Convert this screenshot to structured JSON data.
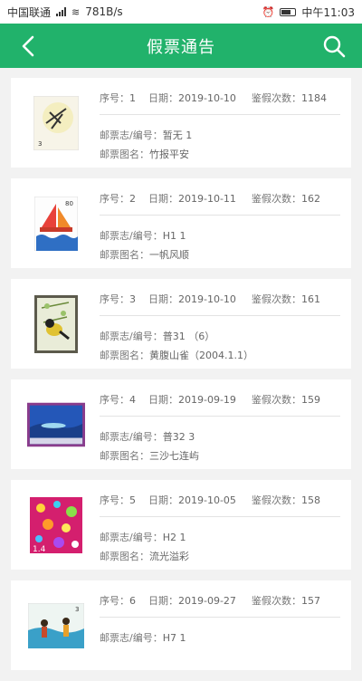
{
  "statusbar": {
    "carrier": "中国联通",
    "speed": "781B/s",
    "time": "中午11:03"
  },
  "header": {
    "title": "假票通告"
  },
  "labels": {
    "seq": "序号：",
    "date": "日期：",
    "count": "鉴假次数：",
    "code": "邮票志/编号：",
    "name": "邮票图名："
  },
  "cards": [
    {
      "seq": "1",
      "date": "2019-10-10",
      "count": "1184",
      "code": "暂无  1",
      "name": "竹报平安"
    },
    {
      "seq": "2",
      "date": "2019-10-11",
      "count": "162",
      "code": "H1  1",
      "name": "一帆风顺"
    },
    {
      "seq": "3",
      "date": "2019-10-10",
      "count": "161",
      "code": "普31  （6）",
      "name": "黄腹山雀（2004.1.1）"
    },
    {
      "seq": "4",
      "date": "2019-09-19",
      "count": "159",
      "code": "普32  3",
      "name": "三沙七连屿"
    },
    {
      "seq": "5",
      "date": "2019-10-05",
      "count": "158",
      "code": "H2  1",
      "name": "流光溢彩"
    },
    {
      "seq": "6",
      "date": "2019-09-27",
      "count": "157",
      "code": "H7  1",
      "name": ""
    }
  ]
}
